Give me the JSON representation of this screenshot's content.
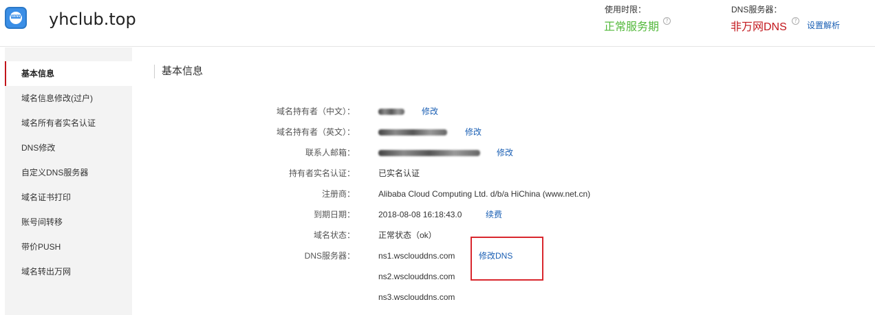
{
  "header": {
    "domain": "yhclub.top",
    "usage_label": "使用时限：",
    "usage_value": "正常服务期",
    "dns_label": "DNS服务器：",
    "dns_value": "非万网DNS",
    "set_resolve": "设置解析",
    "colors": {
      "usage": "#52b83a",
      "dns": "#c2151b",
      "link": "#1a5fb4"
    }
  },
  "sidebar": {
    "items": [
      {
        "label": "基本信息",
        "active": true
      },
      {
        "label": "域名信息修改(过户)"
      },
      {
        "label": "域名所有者实名认证"
      },
      {
        "label": "DNS修改"
      },
      {
        "label": "自定义DNS服务器"
      },
      {
        "label": "域名证书打印"
      },
      {
        "label": "账号间转移"
      },
      {
        "label": "带价PUSH"
      },
      {
        "label": "域名转出万网"
      }
    ]
  },
  "main": {
    "title": "基本信息",
    "rows": [
      {
        "label": "域名持有者（中文）：",
        "value": "",
        "redacted": true,
        "action": "修改"
      },
      {
        "label": "域名持有者（英文）：",
        "value": "",
        "redacted": true,
        "action": "修改"
      },
      {
        "label": "联系人邮箱：",
        "value": "",
        "redacted": true,
        "action": "修改"
      },
      {
        "label": "持有者实名认证：",
        "value": "已实名认证"
      },
      {
        "label": "注册商：",
        "value": "Alibaba Cloud Computing Ltd. d/b/a HiChina (www.net.cn)"
      },
      {
        "label": "到期日期：",
        "value": "2018-08-08 16:18:43.0",
        "action": "续费"
      },
      {
        "label": "域名状态：",
        "value": "正常状态（ok）"
      },
      {
        "label": "DNS服务器：",
        "value": "ns1.wsclouddns.com",
        "action": "修改DNS"
      },
      {
        "label": "",
        "value": "ns2.wsclouddns.com"
      },
      {
        "label": "",
        "value": "ns3.wsclouddns.com"
      }
    ]
  }
}
